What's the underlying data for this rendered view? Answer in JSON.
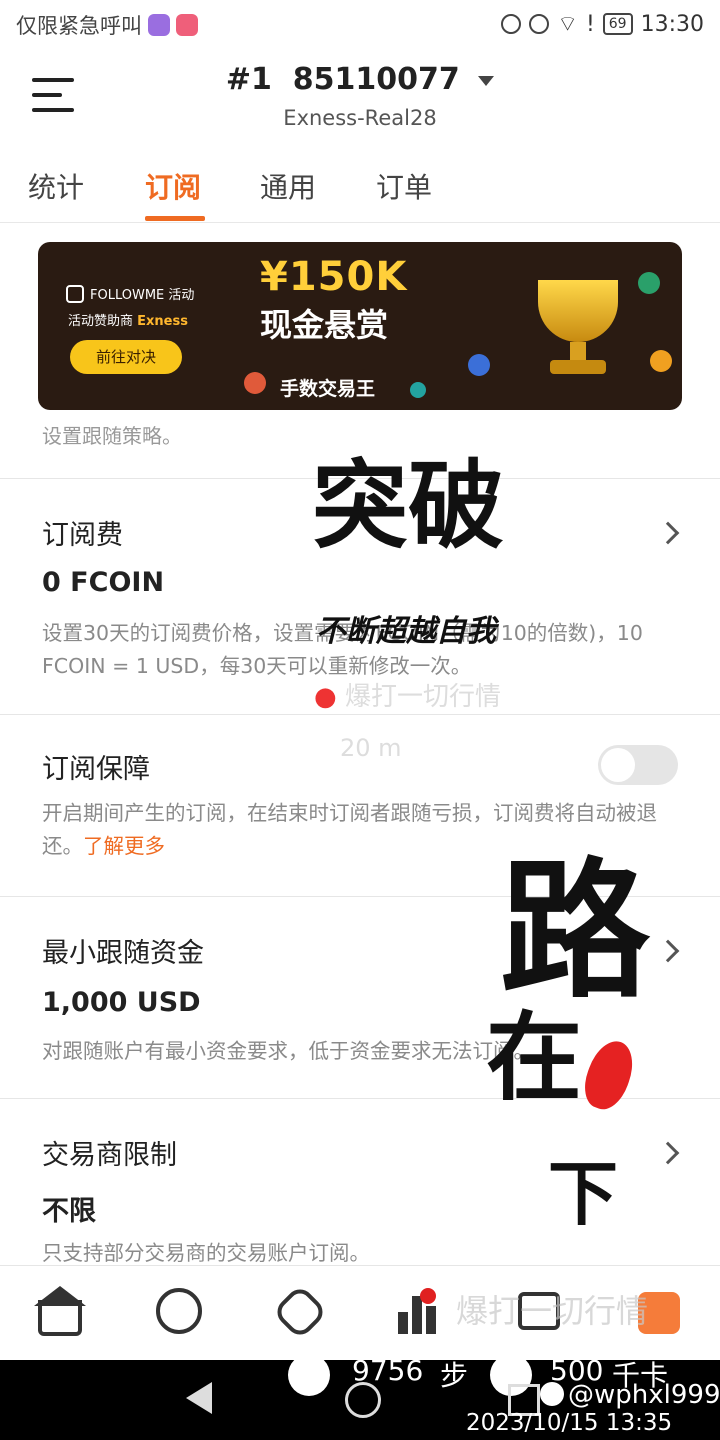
{
  "status_bar": {
    "carrier_text": "仅限紧急呼叫",
    "battery": "69",
    "time": "13:30"
  },
  "header": {
    "rank": "#1",
    "account_number": "85110077",
    "server": "Exness-Real28"
  },
  "tabs": [
    {
      "label": "统计"
    },
    {
      "label": "订阅"
    },
    {
      "label": "通用"
    },
    {
      "label": "订单"
    }
  ],
  "banner": {
    "logo_text": "FOLLOWME 活动",
    "sponsor_prefix": "活动赞助商",
    "sponsor_name": "Exness",
    "button_label": "前往对决",
    "amount": "¥150K",
    "headline": "现金悬赏",
    "subline": "手数交易王"
  },
  "content": {
    "clipped_text": "设置跟随策略。",
    "sections": [
      {
        "title": "订阅费",
        "value": "0 FCOIN",
        "desc": "设置30天的订阅费价格，设置需要为FCOIN（需为10的倍数)，10 FCOIN = 1 USD，每30天可以重新修改一次。"
      },
      {
        "title": "订阅保障",
        "desc": "开启期间产生的订阅，在结束时订阅者跟随亏损，订阅费将自动被退还。",
        "link": "了解更多"
      },
      {
        "title": "最小跟随资金",
        "value": "1,000 USD",
        "desc": "对跟随账户有最小资金要求，低于资金要求无法订阅。"
      },
      {
        "title": "交易商限制",
        "value": "不限",
        "desc": "只支持部分交易商的交易账户订阅。"
      }
    ]
  },
  "watermark": {
    "big1": "突破",
    "line1": "不断超越自我",
    "line2": "爆打一切行情",
    "distance": "20 m",
    "big2": "路",
    "big3": "在",
    "big4": "下",
    "nav_overlay": "爆打一切行情"
  },
  "overlay_bottom": {
    "steps": "9756",
    "steps_unit": "步",
    "calories": "500",
    "calories_unit": "千卡",
    "handle": "@wphxl999",
    "datetime": "2023/10/15 13:35"
  }
}
